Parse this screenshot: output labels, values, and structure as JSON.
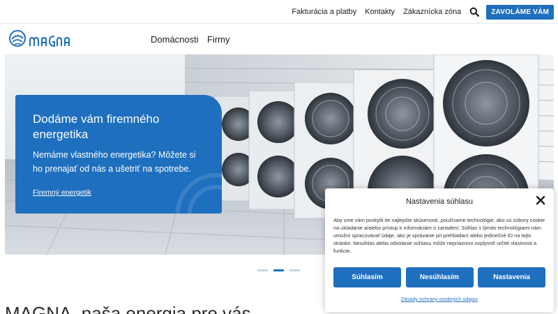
{
  "topbar": {
    "links": [
      "Fakturácia a platby",
      "Kontakty",
      "Zákaznícka zóna"
    ],
    "search_icon": "search-icon",
    "cta_label": "ZAVOLÁME VÁM"
  },
  "brand": {
    "logo_text": "MAGNA",
    "accent_color": "#1f6fbf"
  },
  "nav": {
    "items": [
      "Domácnosti",
      "Firmy"
    ]
  },
  "hero": {
    "title": "Dodáme vám firemného energetika",
    "text": "Nemáme vlastného energetika? Môžete si ho prenajať od nás a ušetriť na spotrebe.",
    "link": "Firemný energetik",
    "image_subject": "outdoor air conditioning units on building roof"
  },
  "slider": {
    "count": 3,
    "active": 1
  },
  "section": {
    "heading": "MAGNA, naša energia pre vás"
  },
  "consent": {
    "title": "Nastavenia súhlasu",
    "body": "Aby sme vám poskytli tie najlepšie skúsenosti, používame technológie, ako sú súbory cookie na ukladanie a/alebo prístup k informáciám o zariadení. Súhlas s týmito technológiami nám umožní spracovávať údaje, ako je správanie pri prehliadaní alebo jedinečné ID na tejto stránke. Nesúhlas alebo odvolanie súhlasu môže nepriaznivo ovplyvniť určité vlastnosti a funkcie.",
    "buttons": [
      "Súhlasím",
      "Nesúhlasím",
      "Nastavenia"
    ],
    "policy_link": "Zásady ochrany osobných údajov",
    "close_icon": "close-icon"
  }
}
